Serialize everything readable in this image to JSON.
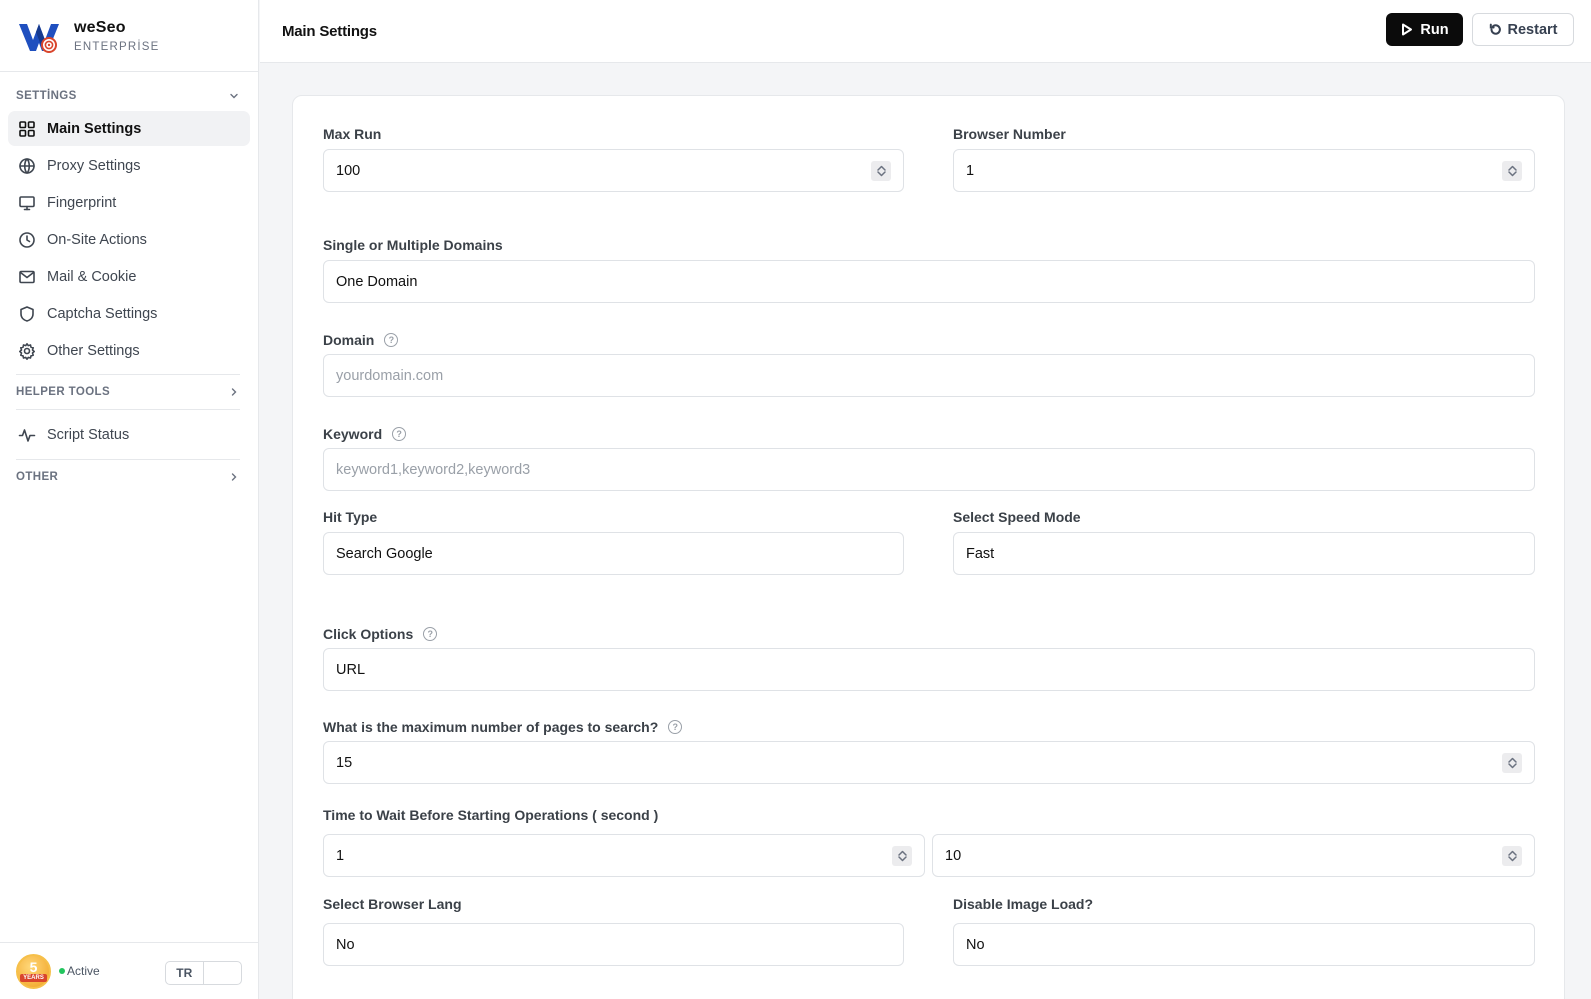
{
  "brand": {
    "name": "weSeo",
    "edition": "ENTERPRİSE"
  },
  "sidebar": {
    "settings_title": "SETTİNGS",
    "items": [
      {
        "label": "Main Settings",
        "icon": "grid-icon"
      },
      {
        "label": "Proxy Settings",
        "icon": "globe-icon"
      },
      {
        "label": "Fingerprint",
        "icon": "monitor-icon"
      },
      {
        "label": "On-Site Actions",
        "icon": "clock-icon"
      },
      {
        "label": "Mail & Cookie",
        "icon": "mail-icon"
      },
      {
        "label": "Captcha Settings",
        "icon": "shield-icon"
      },
      {
        "label": "Other Settings",
        "icon": "gear-icon"
      }
    ],
    "helper_title": "HELPER TOOLS",
    "script_status": "Script Status",
    "other_title": "OTHER"
  },
  "footer": {
    "badge_number": "5",
    "badge_years": "YEARS",
    "status": "Active",
    "lang_selected": "TR",
    "lang_other": ""
  },
  "header": {
    "title": "Main Settings",
    "run_label": "Run",
    "restart_label": "Restart"
  },
  "form": {
    "max_run": {
      "label": "Max Run",
      "value": "100"
    },
    "browser_number": {
      "label": "Browser Number",
      "value": "1"
    },
    "domains_mode": {
      "label": "Single or Multiple Domains",
      "value": "One Domain"
    },
    "domain": {
      "label": "Domain",
      "placeholder": "yourdomain.com"
    },
    "keyword": {
      "label": "Keyword",
      "placeholder": "keyword1,keyword2,keyword3"
    },
    "hit_type": {
      "label": "Hit Type",
      "value": "Search Google"
    },
    "speed_mode": {
      "label": "Select Speed Mode",
      "value": "Fast"
    },
    "click_options": {
      "label": "Click Options",
      "value": "URL"
    },
    "max_pages": {
      "label": "What is the maximum number of pages to search?",
      "value": "15"
    },
    "wait_time": {
      "label": "Time to Wait Before Starting Operations ( second )",
      "min": "1",
      "max": "10"
    },
    "browser_lang": {
      "label": "Select Browser Lang",
      "value": "No"
    },
    "disable_image": {
      "label": "Disable Image Load?",
      "value": "No"
    }
  },
  "help_glyph": "?",
  "colors": {
    "active_dot": "#22c55e",
    "run_button": "#0b0b0b",
    "brand_blue": "#1f4fbf"
  }
}
